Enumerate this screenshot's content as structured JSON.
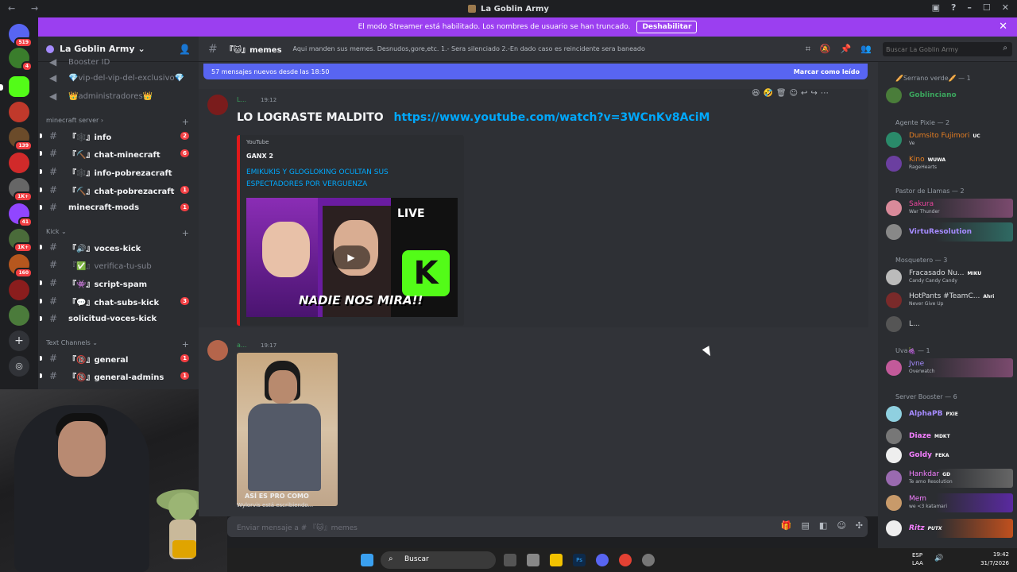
{
  "window": {
    "title": "La Goblin Army"
  },
  "banner": {
    "text": "El modo Streamer está habilitado. Los nombres de usuario se han truncado.",
    "button": "Deshabilitar"
  },
  "rail": {
    "badges": [
      "519",
      "4",
      "139",
      "1K+",
      "41",
      "1K+",
      "160"
    ]
  },
  "sidebar": {
    "server_name": "La Goblin Army",
    "top_channels": [
      {
        "label": "Booster ID",
        "icon": "💎"
      },
      {
        "label": "💎vip-del-vip-del-exclusivo💎"
      },
      {
        "label": "👑administradores👑"
      }
    ],
    "categories": [
      {
        "name": "minecraft server",
        "channels": [
          {
            "label": "『🕸️』info",
            "badge": "2"
          },
          {
            "label": "『⛏️』chat-minecraft",
            "badge": "6"
          },
          {
            "label": "『🕸️』info-pobrezacraft",
            "badge": ""
          },
          {
            "label": "『⛏️』chat-pobrezacraft",
            "badge": "1"
          },
          {
            "label": "minecraft-mods",
            "badge": "1"
          }
        ]
      },
      {
        "name": "Kick",
        "channels": [
          {
            "label": "『🔊』voces-kick",
            "badge": ""
          },
          {
            "label": "『✅』verifica-tu-sub",
            "badge": ""
          },
          {
            "label": "『👾』script-spam",
            "badge": ""
          },
          {
            "label": "『💬』chat-subs-kick",
            "badge": "3"
          },
          {
            "label": "solicitud-voces-kick",
            "badge": ""
          }
        ]
      },
      {
        "name": "Text Channels",
        "channels": [
          {
            "label": "『🔞』general",
            "badge": "1"
          },
          {
            "label": "『🔞』general-admins",
            "badge": "1"
          }
        ]
      }
    ]
  },
  "channel": {
    "name": "『🐱』memes",
    "topic": "Aqui manden sus memes. Desnudos,gore,etc. 1.- Sera silenciado 2.-En dado caso es reincidente sera baneado",
    "search_placeholder": "Buscar La Goblin Army"
  },
  "new_messages": {
    "text": "57 mensajes nuevos desde las 18:50",
    "action": "Marcar como leído"
  },
  "messages": [
    {
      "user": "L...",
      "time": "19:12",
      "text": "LO LOGRASTE MALDITO",
      "link": "https://www.youtube.com/watch?v=3WCnKv8AciM",
      "embed": {
        "provider": "YouTube",
        "author": "GANX 2",
        "title": "EMIKUKIS Y GLOGLOKING OCULTAN SUS ESPECTADORES POR VERGUENZA",
        "thumb_text": "NADIE NOS MIRA!!",
        "live": "LIVE"
      }
    },
    {
      "user": "a...",
      "time": "19:17",
      "image_caption": "ASÍ ES PRO COMO",
      "typing": "Wylorvis está escribiendo..."
    }
  ],
  "composer": {
    "placeholder": "Enviar mensaje a # 『🐱』memes"
  },
  "members": {
    "groups": [
      {
        "name": "🥖Serrano verde🥖 — 1",
        "members": [
          {
            "name": "Goblinciano",
            "status": "",
            "color": "#3ba55d",
            "tag": ""
          }
        ]
      },
      {
        "name": "Agente Pixie — 2",
        "members": [
          {
            "name": "Dumsito Fujimori",
            "status": "Ve",
            "color": "#e67e22",
            "tag": "UC"
          },
          {
            "name": "Kino",
            "status": "RageHearts",
            "color": "#e67e22",
            "tag": "WUWA"
          }
        ]
      },
      {
        "name": "Pastor de Llamas — 2",
        "members": [
          {
            "name": "Sakura",
            "status": "War Thunder",
            "color": "#eb459e",
            "tag": ""
          },
          {
            "name": "VirtuResolution",
            "status": "",
            "color": "#a58bff",
            "tag": ""
          }
        ]
      },
      {
        "name": "Mosquetero — 3",
        "members": [
          {
            "name": "Fracasado Nu...",
            "status": "Candy Candy Candy",
            "color": "#dbdee1",
            "tag": "MIKU"
          },
          {
            "name": "HotPants #TeamC...",
            "status": "Never Give Up",
            "color": "#dbdee1",
            "tag": "Ahri"
          },
          {
            "name": "L...",
            "status": "",
            "color": "#dbdee1",
            "tag": ""
          }
        ]
      },
      {
        "name": "Uva🍇 — 1",
        "members": [
          {
            "name": "Jvne",
            "status": "Overwatch",
            "color": "#a58bff",
            "tag": ""
          }
        ]
      },
      {
        "name": "Server Booster — 6",
        "members": [
          {
            "name": "AlphaPB",
            "status": "",
            "color": "#a58bff",
            "tag": "PXIE"
          },
          {
            "name": "Diaze",
            "status": "",
            "color": "#f47fff",
            "tag": "MDKT"
          },
          {
            "name": "Goldy",
            "status": "",
            "color": "#f47fff",
            "tag": "FEKA"
          },
          {
            "name": "Hankdar",
            "status": "Te amo Resolution",
            "color": "#f47fff",
            "tag": "GD"
          },
          {
            "name": "Mem",
            "status": "we <3 katamari",
            "color": "#f47fff",
            "tag": ""
          },
          {
            "name": "Ritz",
            "status": "",
            "color": "#f47fff",
            "tag": "PUTX"
          }
        ]
      }
    ]
  },
  "taskbar": {
    "search": "Buscar",
    "lang": "ESP",
    "lang2": "LAA",
    "time": "19:42",
    "date": "31/7/2026"
  }
}
